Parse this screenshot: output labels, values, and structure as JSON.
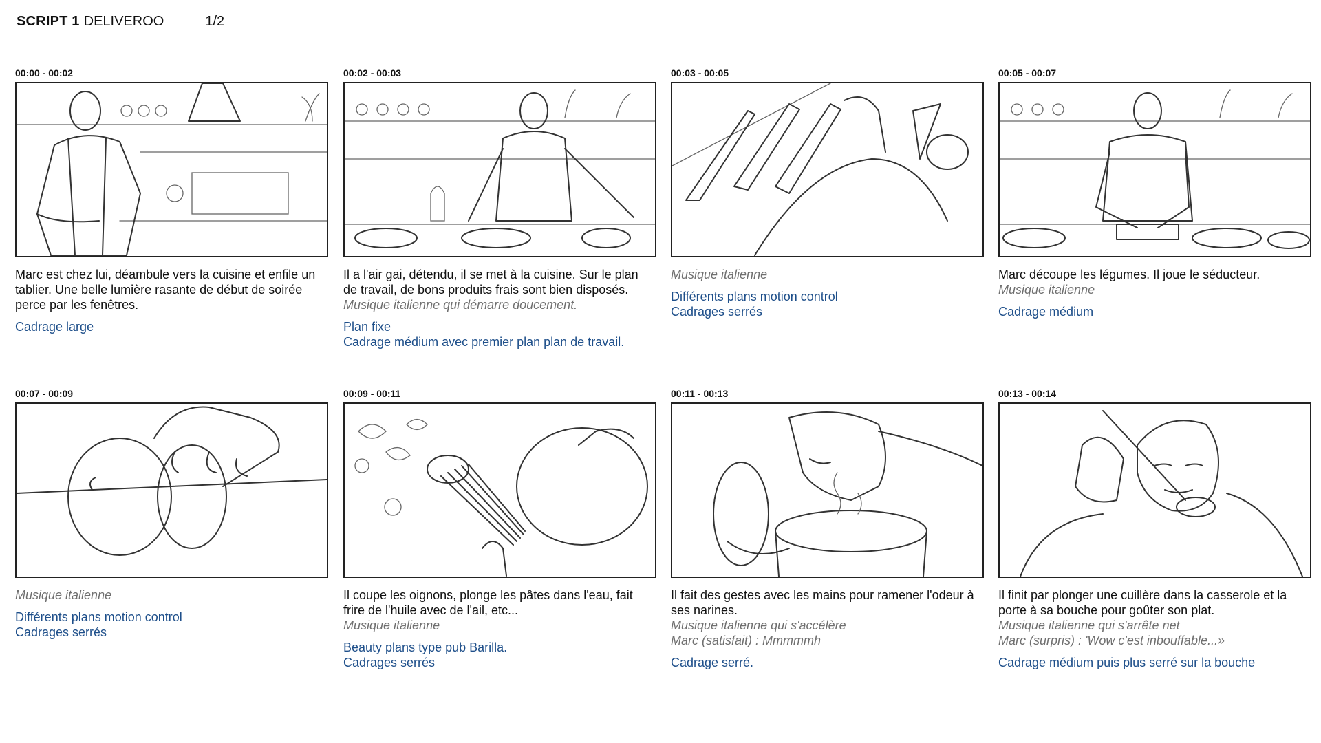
{
  "header": {
    "script": "SCRIPT 1",
    "brand": "DELIVEROO",
    "page": "1/2"
  },
  "panels": [
    {
      "time": "00:00 - 00:02",
      "action": [
        "Marc est chez lui, déambule vers la cuisine et enfile un",
        "tablier. Une belle lumière rasante de début de soirée",
        "perce par les fenêtres."
      ],
      "music": [],
      "framing": [
        "Cadrage large"
      ]
    },
    {
      "time": "00:02 - 00:03",
      "action": [
        "Il a l'air gai, détendu, il se met à la cuisine. Sur le plan",
        "de travail, de bons produits frais sont bien disposés."
      ],
      "music": [
        "Musique italienne qui démarre doucement."
      ],
      "framing": [
        "Plan fixe",
        "Cadrage médium avec premier plan plan de travail."
      ]
    },
    {
      "time": "00:03 - 00:05",
      "action": [],
      "music": [
        "Musique italienne"
      ],
      "framing": [
        "Différents plans motion control",
        "Cadrages serrés"
      ]
    },
    {
      "time": "00:05 - 00:07",
      "action": [
        "Marc découpe les légumes. Il joue le séducteur."
      ],
      "music": [
        "Musique italienne"
      ],
      "framing": [
        "Cadrage médium"
      ]
    },
    {
      "time": "00:07 - 00:09",
      "action": [],
      "music": [
        "Musique italienne"
      ],
      "framing": [
        "Différents plans motion control",
        "Cadrages serrés"
      ]
    },
    {
      "time": "00:09 - 00:11",
      "action": [
        "Il coupe les oignons, plonge les pâtes dans l'eau, fait",
        "frire de l'huile avec de l'ail, etc..."
      ],
      "music": [
        "Musique italienne"
      ],
      "framing": [
        "Beauty plans type pub Barilla.",
        "Cadrages serrés"
      ]
    },
    {
      "time": "00:11 - 00:13",
      "action": [
        "Il fait des gestes avec les mains pour ramener l'odeur à",
        "ses narines."
      ],
      "music": [
        "Musique italienne qui s'accélère",
        "Marc (satisfait) : Mmmmmh"
      ],
      "framing": [
        "Cadrage serré."
      ]
    },
    {
      "time": "00:13 - 00:14",
      "action": [
        "Il finit par plonger une cuillère dans la casserole et la",
        "porte à sa bouche pour goûter son plat."
      ],
      "music": [
        "Musique italienne qui s'arrête net",
        "Marc (surpris) : 'Wow c'est inbouffable...»"
      ],
      "framing": [
        "Cadrage médium puis plus serré sur la bouche"
      ]
    }
  ]
}
